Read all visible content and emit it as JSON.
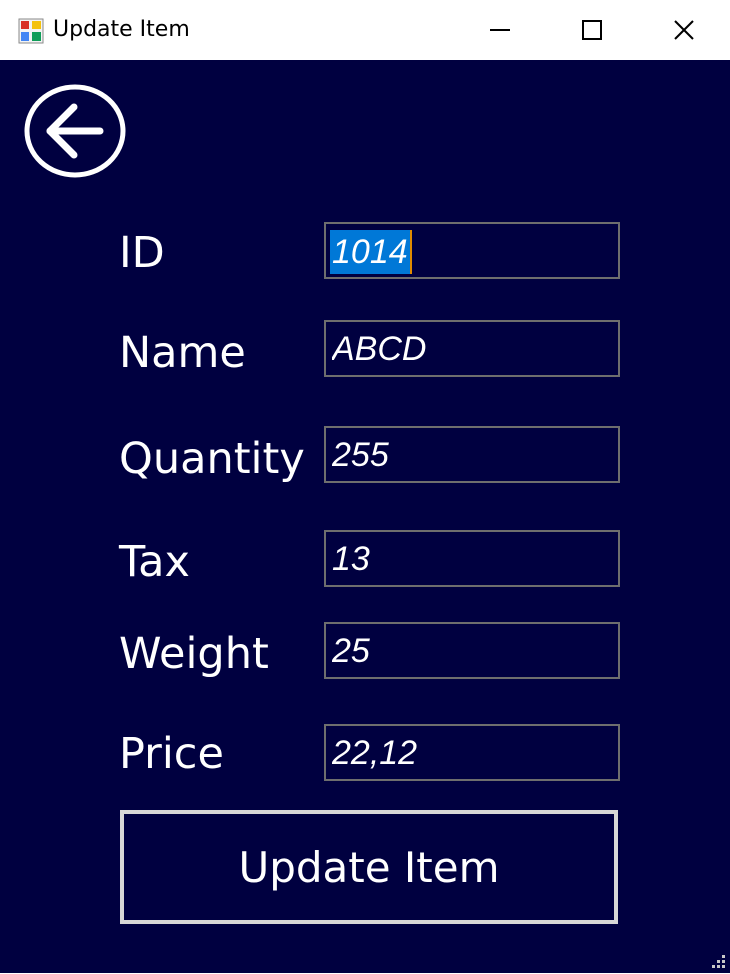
{
  "window": {
    "title": "Update Item"
  },
  "form": {
    "fields": [
      {
        "label": "ID",
        "value": "1014"
      },
      {
        "label": "Name",
        "value": "ABCD"
      },
      {
        "label": "Quantity",
        "value": "255"
      },
      {
        "label": "Tax",
        "value": "13"
      },
      {
        "label": "Weight",
        "value": "25"
      },
      {
        "label": "Price",
        "value": "22,12"
      }
    ],
    "submit_label": "Update Item"
  },
  "colors": {
    "background": "#000040",
    "text": "#ffffff",
    "selection": "#0078d7"
  },
  "icons": {
    "app": "app-icon",
    "back": "back-arrow-icon",
    "minimize": "minimize-icon",
    "maximize": "maximize-icon",
    "close": "close-icon",
    "resize": "resize-grip-icon"
  }
}
